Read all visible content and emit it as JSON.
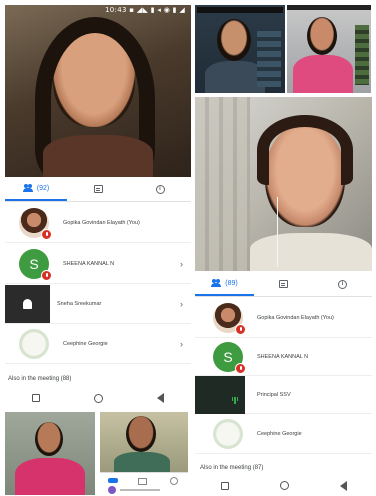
{
  "left": {
    "status_time": "10:43 ▪ ◢◣ ▮ ◂ ◉ ▮ ◢",
    "tabs": {
      "people_count": "(92)"
    },
    "participants": [
      {
        "name": "Gopika Govindan Elayath (You)",
        "avatar": "photo",
        "muted": true,
        "chevron": false
      },
      {
        "name": "SHEENA KANNAL N",
        "avatar": "green",
        "initial": "S",
        "muted": true,
        "chevron": true
      },
      {
        "name": "Sneha Sreekumar",
        "avatar": "dark",
        "muted": true,
        "chevron": true
      },
      {
        "name": "Ceephine Georgie",
        "avatar": "logo",
        "muted": false,
        "chevron": true
      }
    ],
    "section_label": "Also in the meeting (88)"
  },
  "right": {
    "tabs": {
      "people_count": "(89)"
    },
    "participants": [
      {
        "name": "Gopika Govindan Elayath (You)",
        "avatar": "photo",
        "muted": true
      },
      {
        "name": "SHEENA KANNAL N",
        "avatar": "green",
        "initial": "S",
        "muted": true
      },
      {
        "name": "Principal SSV",
        "avatar": "dark",
        "muted": false
      },
      {
        "name": "Ceephine Georgie",
        "avatar": "logo",
        "muted": false
      }
    ],
    "section_label": "Also in the meeting (87)"
  },
  "colors": {
    "accent": "#1a73e8",
    "mute": "#d93025",
    "avatar_green": "#3f9b3f"
  }
}
